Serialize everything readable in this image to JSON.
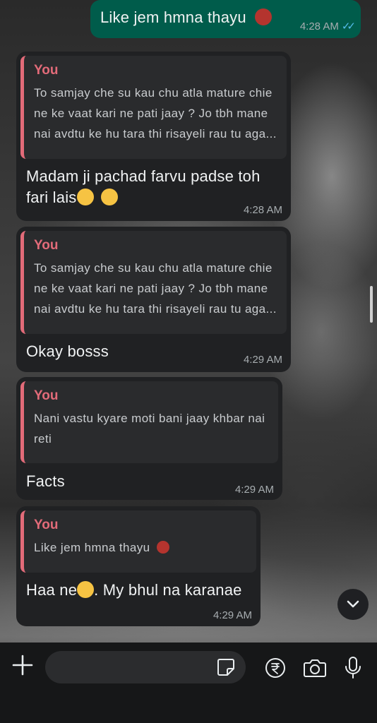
{
  "messages": [
    {
      "kind": "outgoing",
      "text": "Like jem hmna thayu",
      "emoji": "devil-face-emoji",
      "time": "4:28 AM",
      "status": "read"
    },
    {
      "kind": "incoming",
      "quote_author": "You",
      "quote_lines": [
        "To samjay che su kau chu atla mature chie",
        "ne ke vaat kari ne pati jaay ? Jo tbh mane",
        "nai avdtu ke hu tara thi risayeli rau tu aga..."
      ],
      "text_lines": [
        "Madam ji pachad farvu padse toh",
        "fari lais"
      ],
      "emoji": "melting-face-emoji",
      "time": "4:28 AM"
    },
    {
      "kind": "incoming",
      "quote_author": "You",
      "quote_lines": [
        "To samjay che su kau chu atla mature chie",
        "ne ke vaat kari ne pati jaay ? Jo tbh mane",
        "nai avdtu ke hu tara thi risayeli rau tu aga..."
      ],
      "text": "Okay bosss",
      "time": "4:29 AM"
    },
    {
      "kind": "incoming",
      "quote_author": "You",
      "quote_lines": [
        "Nani vastu kyare moti bani jaay khbar nai",
        "reti"
      ],
      "text": "Facts",
      "time": "4:29 AM"
    },
    {
      "kind": "incoming",
      "quote_author": "You",
      "quote_text": "Like jem hmna thayu",
      "text_a": "Haa ne",
      "text_b": ". My bhul na karanae",
      "emoji": "grinning-sweat-emoji",
      "time": "4:29 AM"
    }
  ],
  "composer": {
    "placeholder": "",
    "icons": [
      "plus-icon",
      "sticker-icon",
      "rupee-payment-icon",
      "camera-icon",
      "microphone-icon"
    ]
  },
  "colors": {
    "outgoing_bubble": "#005c4b",
    "incoming_bubble": "#202123",
    "quote_accent": "#e26b79",
    "read_ticks": "#53bdeb"
  }
}
